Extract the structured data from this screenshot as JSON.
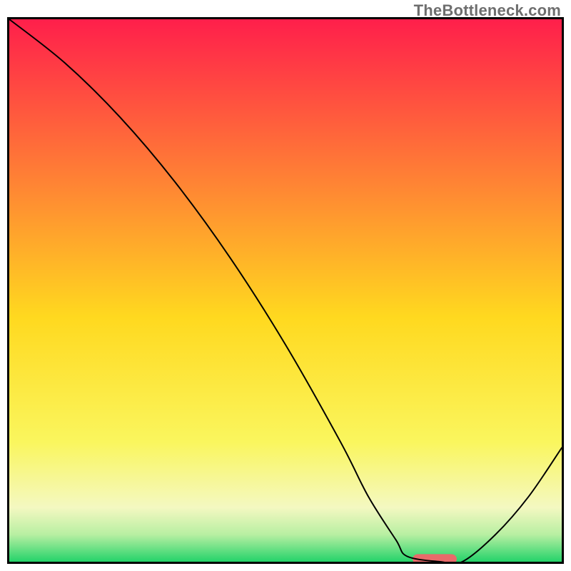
{
  "watermark": "TheBottleneck.com",
  "chart_data": {
    "type": "line",
    "title": "",
    "xlabel": "",
    "ylabel": "",
    "xlim": [
      0,
      100
    ],
    "ylim": [
      0,
      100
    ],
    "grid": false,
    "legend": false,
    "annotations": [],
    "background_gradient": {
      "stops": [
        {
          "pos": 0.0,
          "color": "#ff1f4b"
        },
        {
          "pos": 0.3,
          "color": "#ff8334"
        },
        {
          "pos": 0.55,
          "color": "#ffd91f"
        },
        {
          "pos": 0.78,
          "color": "#faf65e"
        },
        {
          "pos": 0.9,
          "color": "#f4f8c1"
        },
        {
          "pos": 0.95,
          "color": "#b8efa2"
        },
        {
          "pos": 1.0,
          "color": "#24d36a"
        }
      ]
    },
    "series": [
      {
        "name": "curve",
        "color": "#000000",
        "stroke_width": 2,
        "x": [
          0,
          10,
          20,
          30,
          40,
          50,
          60,
          65,
          70,
          72,
          78,
          82,
          88,
          94,
          100
        ],
        "y": [
          100,
          92,
          82,
          70,
          56,
          40,
          22,
          12,
          4,
          1,
          0,
          0,
          5,
          12,
          21
        ]
      }
    ],
    "marker": {
      "name": "optimum-marker",
      "x_center": 77,
      "y_center": 0.5,
      "width": 8,
      "height": 1.8,
      "rx": 1.0,
      "color": "#e86a6a"
    }
  }
}
